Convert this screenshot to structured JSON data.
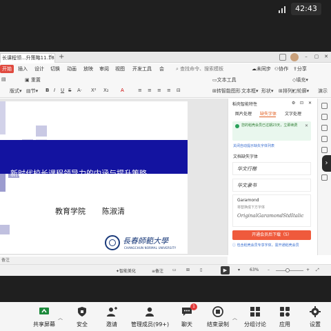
{
  "meeting": {
    "time": "42:43",
    "toolbar": [
      {
        "label": "共享屏幕",
        "icon": "screen-share-icon"
      },
      {
        "label": "安全",
        "icon": "shield-icon"
      },
      {
        "label": "邀请",
        "icon": "invite-user-icon"
      },
      {
        "label": "管理成员(99+)",
        "icon": "members-icon"
      },
      {
        "label": "聊天",
        "icon": "chat-icon",
        "badge": "1"
      },
      {
        "label": "结束录制",
        "icon": "record-stop-icon"
      },
      {
        "label": "分组讨论",
        "icon": "breakout-icon"
      },
      {
        "label": "应用",
        "icon": "apps-icon"
      },
      {
        "label": "设置",
        "icon": "gear-icon"
      }
    ]
  },
  "app": {
    "tab_title": "长课程领...升策略11.18",
    "menu": [
      "开始",
      "插入",
      "设计",
      "切换",
      "动画",
      "放映",
      "审阅",
      "视图",
      "开发工具",
      "会"
    ],
    "search_placeholder": "查找命令、搜索模板",
    "right_menu": [
      "未同步",
      "协作",
      "分享"
    ],
    "ribbon": {
      "new_slide": "重置",
      "layout": "版式",
      "section": "节",
      "textbox": "文本框",
      "shape": "形状",
      "arrange": "排列",
      "fill": "填充",
      "outline": "轮廓",
      "present": "演示",
      "text_tool": "文本工具",
      "smart_graphic": "转智能图形"
    }
  },
  "slide": {
    "title": "新时代校长课程领导力的内涵与提升策略",
    "college": "教育学院",
    "author": "陈淑清",
    "university_cn": "長春師範大學",
    "university_en": "CHANGCHUN NORMAL UNIVERSITY"
  },
  "panel": {
    "header": "稻壳智能特性",
    "tabs": [
      "图片处理",
      "缺失字体",
      "文字处理"
    ],
    "active_tab": "缺失字体",
    "notice": "您的稻壳会员已过期23天，立即续费",
    "link": "关闭自动提示缺失字体列表",
    "section": "文档缺失字体",
    "fonts": [
      "华文行楷",
      "华文隶书"
    ],
    "garamond": {
      "name": "Garamond",
      "desc": "将替换成下方字体",
      "sample": "OriginalGaramondStdItalic"
    },
    "download": "开通会员后下载（5）",
    "vip_note": "包含稻壳会员专享字体，需开通稻壳会员"
  },
  "status": {
    "notes": "备注",
    "beautify": "智能美化",
    "notes_toggle": "备注",
    "zoom": "63%"
  }
}
